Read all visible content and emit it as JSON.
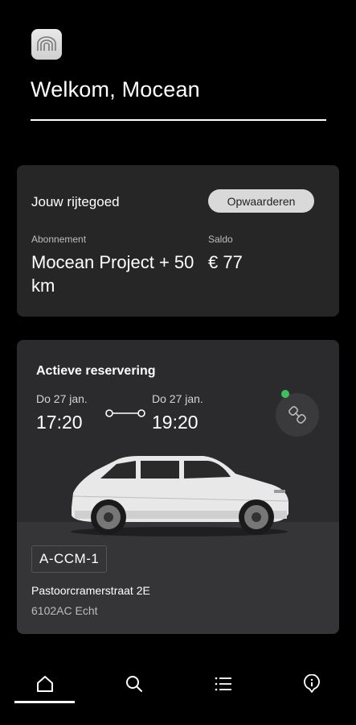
{
  "header": {
    "logo_icon": "arch-logo-icon",
    "welcome": "Welkom, Mocean"
  },
  "balance_card": {
    "title": "Jouw rijtegoed",
    "topup_label": "Opwaarderen",
    "subscription_label": "Abonnement",
    "subscription_value": "Mocean Project + 50 km",
    "saldo_label": "Saldo",
    "saldo_value": "€ 77"
  },
  "reservation": {
    "title": "Actieve reservering",
    "start_date": "Do 27 jan.",
    "start_time": "17:20",
    "end_date": "Do 27 jan.",
    "end_time": "19:20",
    "status_color": "#3fbf5e",
    "key_icon": "key-icon",
    "license_plate": "A-CCM-1",
    "street": "Pastoorcramerstraat 2E",
    "city": "6102AC Echt"
  },
  "nav": {
    "items": [
      "home-icon",
      "search-icon",
      "list-icon",
      "info-icon"
    ],
    "active": "home-icon"
  }
}
